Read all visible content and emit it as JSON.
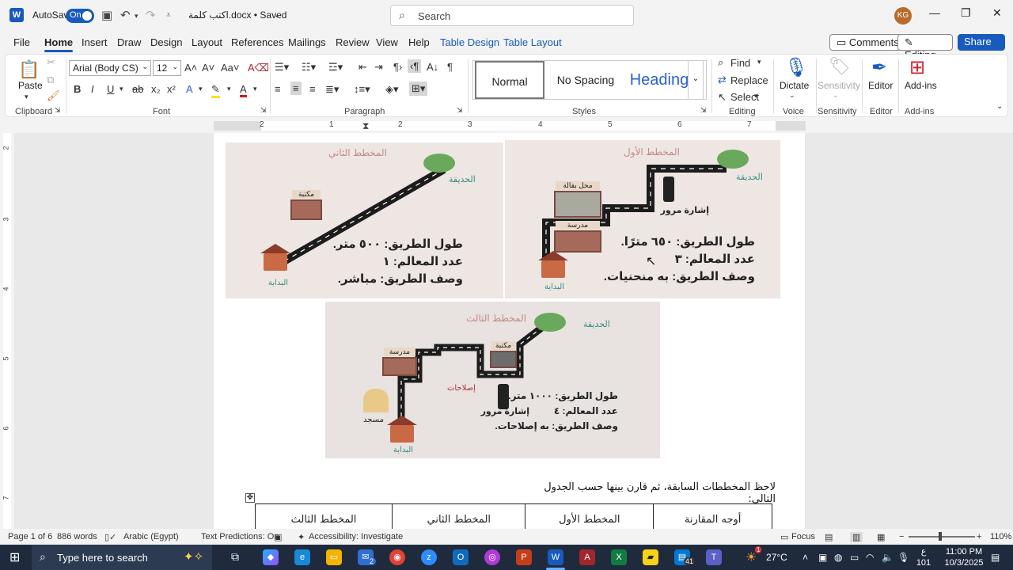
{
  "titlebar": {
    "autosave_label": "AutoSave",
    "autosave_state": "On",
    "doc_title": "اكتب كلمة.docx • Saved",
    "search_placeholder": "Search",
    "user_initials": "KG"
  },
  "tabs": [
    "File",
    "Home",
    "Insert",
    "Draw",
    "Design",
    "Layout",
    "References",
    "Mailings",
    "Review",
    "View",
    "Help",
    "Table Design",
    "Table Layout"
  ],
  "tab_buttons": {
    "comments": "Comments",
    "editing": "Editing",
    "share": "Share"
  },
  "ribbon": {
    "clipboard": {
      "paste": "Paste",
      "label": "Clipboard"
    },
    "font": {
      "name": "Arial (Body CS)",
      "size": "12",
      "label": "Font"
    },
    "paragraph": {
      "label": "Paragraph"
    },
    "styles": {
      "items": [
        "Normal",
        "No Spacing",
        "Heading"
      ],
      "label": "Styles"
    },
    "editing": {
      "find": "Find",
      "replace": "Replace",
      "select": "Select",
      "label": "Editing"
    },
    "voice": {
      "dictate": "Dictate",
      "label": "Voice"
    },
    "sensitivity": {
      "btn": "Sensitivity",
      "label": "Sensitivity"
    },
    "editor": {
      "btn": "Editor",
      "label": "Editor"
    },
    "addins": {
      "btn": "Add-ins",
      "label": "Add-ins"
    }
  },
  "ruler": {
    "numbers": [
      "2",
      "1",
      "1",
      "2",
      "3",
      "4",
      "5",
      "6",
      "7"
    ]
  },
  "vruler": {
    "numbers": [
      "2",
      "3",
      "4",
      "5",
      "6",
      "7"
    ]
  },
  "document": {
    "img1": {
      "title": "المخطط الأول",
      "garden": "الحديقة",
      "shop": "محل بقالة",
      "school": "مدرسة",
      "light": "إشارة مرور",
      "length": "طول الطريق: ٦٥٠ مترًا.",
      "landmarks": "عدد المعالم: ٣",
      "desc": "وصف الطريق: به منحنيات.",
      "start": "البداية"
    },
    "img2": {
      "title": "المخطط الثاني",
      "garden": "الحديقة",
      "library": "مكتبة",
      "length": "طول الطريق: ٥٠٠ متر.",
      "landmarks": "عدد المعالم: ١",
      "desc": "وصف الطريق: مباشر.",
      "start": "البداية"
    },
    "img3": {
      "title": "المخطط الثالث",
      "garden": "الحديقة",
      "school": "مدرسة",
      "library": "مكتبة",
      "repairs": "إصلاحات",
      "mosque": "مسجد",
      "light": "إشارة مرور",
      "length": "طول الطريق: ١٠٠٠ متر.",
      "landmarks": "عدد المعالم: ٤",
      "desc": "وصف الطريق: به إصلاحات.",
      "start": "البداية"
    },
    "instruction": "لاحظ المخططات السابقة، ثم قارن بينها حسب الجدول التالي:",
    "table_headers": [
      "أوجه المقارنة",
      "المخطط الأول",
      "المخطط الثاني",
      "المخطط الثالث"
    ]
  },
  "statusbar": {
    "page": "Page 1 of 6",
    "words": "886 words",
    "language": "Arabic (Egypt)",
    "predictions": "Text Predictions: On",
    "accessibility": "Accessibility: Investigate",
    "focus": "Focus",
    "zoom": "110%"
  },
  "taskbar": {
    "search_placeholder": "Type here to search",
    "weather": "27°C",
    "lang_top": "ع",
    "lang_bottom": "101",
    "time": "11:00 PM",
    "date": "10/3/2025",
    "mail_badge": "2",
    "teams_badge": "41",
    "weather_badge": "1"
  },
  "colors": {
    "accent": "#185abd",
    "taskbar": "#1f2a3d"
  }
}
